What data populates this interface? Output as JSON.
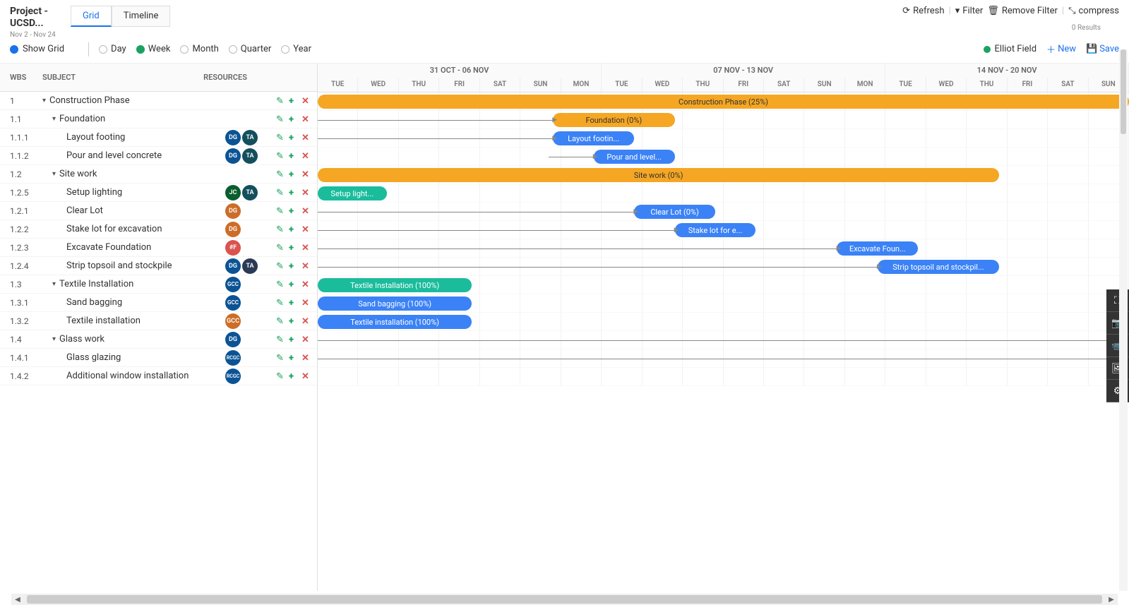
{
  "project": {
    "title": "Project - UCSD...",
    "date_range": "Nov 2 - Nov 24"
  },
  "tabs": {
    "grid": "Grid",
    "timeline": "Timeline"
  },
  "actions": {
    "refresh": "Refresh",
    "filter": "Filter",
    "remove_filter": "Remove Filter",
    "compress": "compress",
    "results": "0 Results"
  },
  "toolbar2": {
    "show_grid": "Show Grid",
    "scales": {
      "day": "Day",
      "week": "Week",
      "month": "Month",
      "quarter": "Quarter",
      "year": "Year"
    },
    "user": "Elliot Field",
    "new": "New",
    "save": "Save"
  },
  "grid_headers": {
    "wbs": "WBS",
    "subject": "SUBJECT",
    "resources": "RESOURCES"
  },
  "timeline_headers": {
    "weeks": [
      "31 OCT - 06 NOV",
      "07 NOV - 13 NOV",
      "14 NOV - 20 NOV"
    ],
    "days": [
      "TUE",
      "WED",
      "THU",
      "FRI",
      "SAT",
      "SUN",
      "MON",
      "TUE",
      "WED",
      "THU",
      "FRI",
      "SAT",
      "SUN",
      "MON",
      "TUE",
      "WED",
      "THU",
      "FRI",
      "SAT",
      "SUN"
    ]
  },
  "tasks": [
    {
      "wbs": "1",
      "subject": "Construction Phase",
      "indent": 1,
      "caret": true
    },
    {
      "wbs": "1.1",
      "subject": "Foundation",
      "indent": 2,
      "caret": true
    },
    {
      "wbs": "1.1.1",
      "subject": "Layout footing",
      "indent": 3
    },
    {
      "wbs": "1.1.2",
      "subject": "Pour and level concrete",
      "indent": 3
    },
    {
      "wbs": "1.2",
      "subject": "Site work",
      "indent": 2,
      "caret": true
    },
    {
      "wbs": "1.2.5",
      "subject": "Setup lighting",
      "indent": 3
    },
    {
      "wbs": "1.2.1",
      "subject": "Clear Lot",
      "indent": 3
    },
    {
      "wbs": "1.2.2",
      "subject": "Stake lot for excavation",
      "indent": 3
    },
    {
      "wbs": "1.2.3",
      "subject": "Excavate Foundation",
      "indent": 3
    },
    {
      "wbs": "1.2.4",
      "subject": "Strip topsoil and stockpile",
      "indent": 3
    },
    {
      "wbs": "1.3",
      "subject": "Textile Installation",
      "indent": 2,
      "caret": true
    },
    {
      "wbs": "1.3.1",
      "subject": "Sand bagging",
      "indent": 3
    },
    {
      "wbs": "1.3.2",
      "subject": "Textile installation",
      "indent": 3
    },
    {
      "wbs": "1.4",
      "subject": "Glass work",
      "indent": 2,
      "caret": true
    },
    {
      "wbs": "1.4.1",
      "subject": "Glass glazing",
      "indent": 3
    },
    {
      "wbs": "1.4.2",
      "subject": "Additional window installation",
      "indent": 3
    }
  ],
  "bars": {
    "construction": "Construction Phase (25%)",
    "foundation": "Foundation (0%)",
    "layout": "Layout footin...",
    "pour": "Pour and level...",
    "sitework": "Site work (0%)",
    "setup": "Setup light...",
    "clear": "Clear Lot (0%)",
    "stake": "Stake lot for e...",
    "excavate": "Excavate Foun...",
    "strip": "Strip topsoil and stockpil...",
    "textile_inst": "Textile Installation (100%)",
    "sand": "Sand bagging (100%)",
    "textile": "Textile installation (100%)"
  },
  "chart_data": {
    "type": "gantt",
    "time_unit": "day",
    "start": "2022-11-01",
    "columns": 20,
    "bars": [
      {
        "row": 0,
        "label": "Construction Phase (25%)",
        "start_col": 0,
        "span": 20,
        "color": "orange",
        "progress": 25
      },
      {
        "row": 1,
        "label": "Foundation (0%)",
        "start_col": 5.8,
        "span": 3,
        "color": "orange",
        "progress": 0
      },
      {
        "row": 2,
        "label": "Layout footin...",
        "start_col": 5.8,
        "span": 2,
        "color": "blue"
      },
      {
        "row": 3,
        "label": "Pour and level...",
        "start_col": 6.8,
        "span": 2,
        "color": "blue"
      },
      {
        "row": 4,
        "label": "Site work (0%)",
        "start_col": 0,
        "span": 16.8,
        "color": "orange",
        "progress": 0
      },
      {
        "row": 5,
        "label": "Setup light...",
        "start_col": 0,
        "span": 1.7,
        "color": "teal"
      },
      {
        "row": 6,
        "label": "Clear Lot (0%)",
        "start_col": 7.8,
        "span": 2,
        "color": "blue",
        "progress": 0
      },
      {
        "row": 7,
        "label": "Stake lot for e...",
        "start_col": 8.8,
        "span": 2,
        "color": "blue"
      },
      {
        "row": 8,
        "label": "Excavate Foun...",
        "start_col": 12.8,
        "span": 2,
        "color": "blue"
      },
      {
        "row": 9,
        "label": "Strip topsoil and stockpil...",
        "start_col": 13.8,
        "span": 3,
        "color": "blue"
      },
      {
        "row": 10,
        "label": "Textile Installation (100%)",
        "start_col": 0,
        "span": 3.8,
        "color": "teal",
        "progress": 100
      },
      {
        "row": 11,
        "label": "Sand bagging (100%)",
        "start_col": 0,
        "span": 3.8,
        "color": "blue",
        "progress": 100
      },
      {
        "row": 12,
        "label": "Textile installation (100%)",
        "start_col": 0,
        "span": 3.8,
        "color": "blue",
        "progress": 100
      }
    ]
  }
}
